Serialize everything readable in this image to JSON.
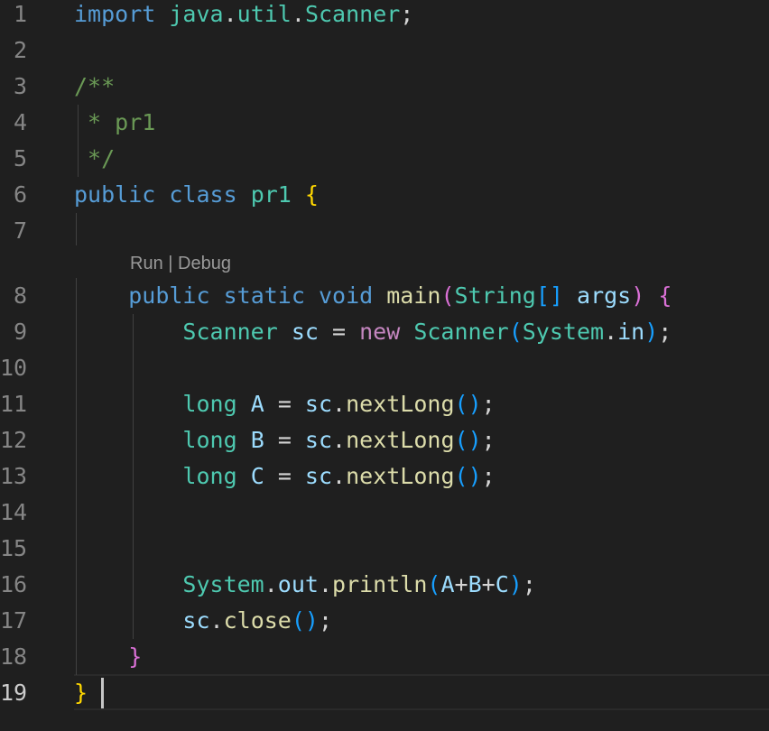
{
  "editor": {
    "language": "java",
    "active_line": 19,
    "codelens": {
      "run": "Run",
      "separator": " | ",
      "debug": "Debug"
    },
    "line_numbers": [
      "1",
      "2",
      "3",
      "4",
      "5",
      "6",
      "7",
      "8",
      "9",
      "10",
      "11",
      "12",
      "13",
      "14",
      "15",
      "16",
      "17",
      "18",
      "19"
    ],
    "colors": {
      "background": "#1f1f1f",
      "keyword": "#569cd6",
      "package": "#4ec9b0",
      "class": "#4ec9b0",
      "comment": "#6a9955",
      "variable": "#9cdcfe",
      "function": "#dcdcaa",
      "operator": "#d4d4d4",
      "control_keyword": "#c586c0",
      "bracket_level1": "#ffd700",
      "bracket_level2": "#da70d6",
      "bracket_level3": "#179fff"
    },
    "lines": [
      {
        "n": "1",
        "tokens": [
          [
            "import",
            "keyword"
          ],
          [
            " ",
            "plain"
          ],
          [
            "java",
            "package"
          ],
          [
            ".",
            "operator"
          ],
          [
            "util",
            "package"
          ],
          [
            ".",
            "operator"
          ],
          [
            "Scanner",
            "class"
          ],
          [
            ";",
            "operator"
          ]
        ]
      },
      {
        "n": "2",
        "tokens": []
      },
      {
        "n": "3",
        "tokens": [
          [
            "/**",
            "comment"
          ]
        ]
      },
      {
        "n": "4",
        "tokens": [
          [
            " * pr1",
            "comment"
          ]
        ]
      },
      {
        "n": "5",
        "tokens": [
          [
            " */",
            "comment"
          ]
        ]
      },
      {
        "n": "6",
        "tokens": [
          [
            "public",
            "keyword"
          ],
          [
            " ",
            "plain"
          ],
          [
            "class",
            "keyword"
          ],
          [
            " ",
            "plain"
          ],
          [
            "pr1",
            "class"
          ],
          [
            " ",
            "plain"
          ],
          [
            "{",
            "bracket_level1"
          ]
        ]
      },
      {
        "n": "7",
        "tokens": []
      },
      {
        "n": "8",
        "tokens": [
          [
            "    ",
            "plain"
          ],
          [
            "public",
            "keyword"
          ],
          [
            " ",
            "plain"
          ],
          [
            "static",
            "keyword"
          ],
          [
            " ",
            "plain"
          ],
          [
            "void",
            "keyword"
          ],
          [
            " ",
            "plain"
          ],
          [
            "main",
            "function"
          ],
          [
            "(",
            "bracket_level2"
          ],
          [
            "String",
            "class"
          ],
          [
            "[]",
            "bracket_level3"
          ],
          [
            " ",
            "plain"
          ],
          [
            "args",
            "variable"
          ],
          [
            ")",
            "bracket_level2"
          ],
          [
            " ",
            "plain"
          ],
          [
            "{",
            "bracket_level2"
          ]
        ]
      },
      {
        "n": "9",
        "tokens": [
          [
            "        ",
            "plain"
          ],
          [
            "Scanner",
            "class"
          ],
          [
            " ",
            "plain"
          ],
          [
            "sc",
            "variable"
          ],
          [
            " = ",
            "operator"
          ],
          [
            "new",
            "control_keyword"
          ],
          [
            " ",
            "plain"
          ],
          [
            "Scanner",
            "class"
          ],
          [
            "(",
            "bracket_level3"
          ],
          [
            "System",
            "class"
          ],
          [
            ".",
            "operator"
          ],
          [
            "in",
            "variable"
          ],
          [
            ")",
            "bracket_level3"
          ],
          [
            ";",
            "operator"
          ]
        ]
      },
      {
        "n": "10",
        "tokens": []
      },
      {
        "n": "11",
        "tokens": [
          [
            "        ",
            "plain"
          ],
          [
            "long",
            "package"
          ],
          [
            " ",
            "plain"
          ],
          [
            "A",
            "variable"
          ],
          [
            " = ",
            "operator"
          ],
          [
            "sc",
            "variable"
          ],
          [
            ".",
            "operator"
          ],
          [
            "nextLong",
            "function"
          ],
          [
            "()",
            "bracket_level3"
          ],
          [
            ";",
            "operator"
          ]
        ]
      },
      {
        "n": "12",
        "tokens": [
          [
            "        ",
            "plain"
          ],
          [
            "long",
            "package"
          ],
          [
            " ",
            "plain"
          ],
          [
            "B",
            "variable"
          ],
          [
            " = ",
            "operator"
          ],
          [
            "sc",
            "variable"
          ],
          [
            ".",
            "operator"
          ],
          [
            "nextLong",
            "function"
          ],
          [
            "()",
            "bracket_level3"
          ],
          [
            ";",
            "operator"
          ]
        ]
      },
      {
        "n": "13",
        "tokens": [
          [
            "        ",
            "plain"
          ],
          [
            "long",
            "package"
          ],
          [
            " ",
            "plain"
          ],
          [
            "C",
            "variable"
          ],
          [
            " = ",
            "operator"
          ],
          [
            "sc",
            "variable"
          ],
          [
            ".",
            "operator"
          ],
          [
            "nextLong",
            "function"
          ],
          [
            "()",
            "bracket_level3"
          ],
          [
            ";",
            "operator"
          ]
        ]
      },
      {
        "n": "14",
        "tokens": []
      },
      {
        "n": "15",
        "tokens": []
      },
      {
        "n": "16",
        "tokens": [
          [
            "        ",
            "plain"
          ],
          [
            "System",
            "class"
          ],
          [
            ".",
            "operator"
          ],
          [
            "out",
            "variable"
          ],
          [
            ".",
            "operator"
          ],
          [
            "println",
            "function"
          ],
          [
            "(",
            "bracket_level3"
          ],
          [
            "A",
            "variable"
          ],
          [
            "+",
            "operator"
          ],
          [
            "B",
            "variable"
          ],
          [
            "+",
            "operator"
          ],
          [
            "C",
            "variable"
          ],
          [
            ")",
            "bracket_level3"
          ],
          [
            ";",
            "operator"
          ]
        ]
      },
      {
        "n": "17",
        "tokens": [
          [
            "        ",
            "plain"
          ],
          [
            "sc",
            "variable"
          ],
          [
            ".",
            "operator"
          ],
          [
            "close",
            "function"
          ],
          [
            "()",
            "bracket_level3"
          ],
          [
            ";",
            "operator"
          ]
        ]
      },
      {
        "n": "18",
        "tokens": [
          [
            "    ",
            "plain"
          ],
          [
            "}",
            "bracket_level2"
          ]
        ]
      },
      {
        "n": "19",
        "tokens": [
          [
            "}",
            "bracket_level1"
          ]
        ]
      }
    ]
  }
}
